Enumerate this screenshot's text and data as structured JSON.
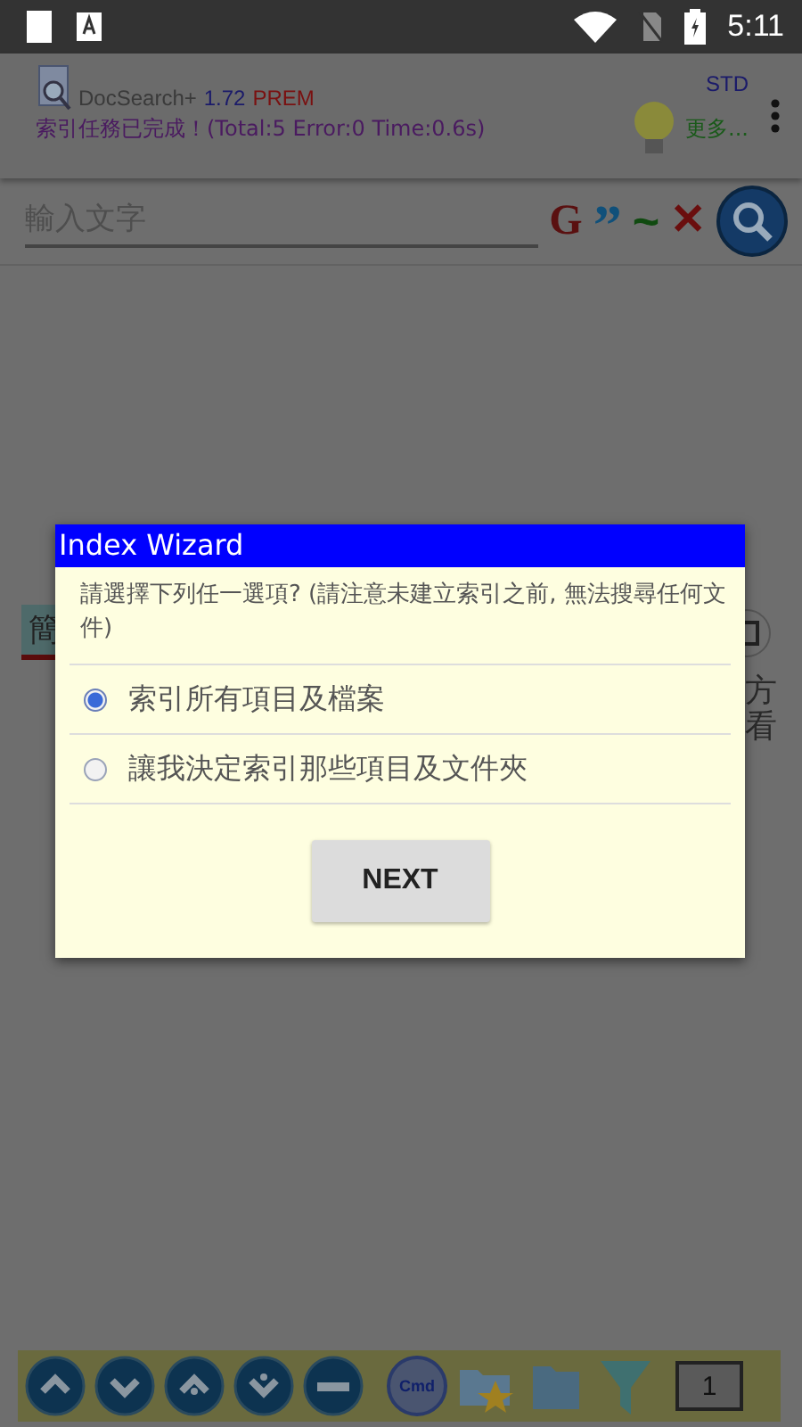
{
  "status_bar": {
    "time": "5:11"
  },
  "header": {
    "app_name": "DocSearch+",
    "version": "1.72",
    "edition": "PREM",
    "mode": "STD",
    "message": "索引任務已完成！(Total:5 Error:0 Time:0.6s)",
    "more": "更多..."
  },
  "search": {
    "placeholder": "輸入文字",
    "buttons": [
      {
        "kind": "google",
        "label": "G"
      },
      {
        "kind": "quote",
        "label": "”"
      },
      {
        "kind": "fuzzy",
        "label": "~"
      },
      {
        "kind": "clear",
        "label": "✕"
      }
    ]
  },
  "background": {
    "tab_fragment": "簡",
    "right_fragments": [
      "方",
      "看"
    ]
  },
  "dialog": {
    "title": "Index Wizard",
    "prompt": "請選擇下列任一選項? (請注意未建立索引之前, 無法搜尋任何文件)",
    "options": [
      {
        "label": "索引所有項目及檔案",
        "selected": true
      },
      {
        "label": "讓我決定索引那些項目及文件夾",
        "selected": false
      }
    ],
    "button": "NEXT"
  },
  "toolbar": {
    "items": [
      {
        "kind": "up"
      },
      {
        "kind": "down"
      },
      {
        "kind": "up-dot"
      },
      {
        "kind": "down-dot"
      },
      {
        "kind": "minus"
      },
      {
        "kind": "cmd",
        "label": "Cmd"
      },
      {
        "kind": "favorites"
      },
      {
        "kind": "folder"
      },
      {
        "kind": "filter"
      },
      {
        "kind": "book",
        "label": "1"
      }
    ]
  }
}
